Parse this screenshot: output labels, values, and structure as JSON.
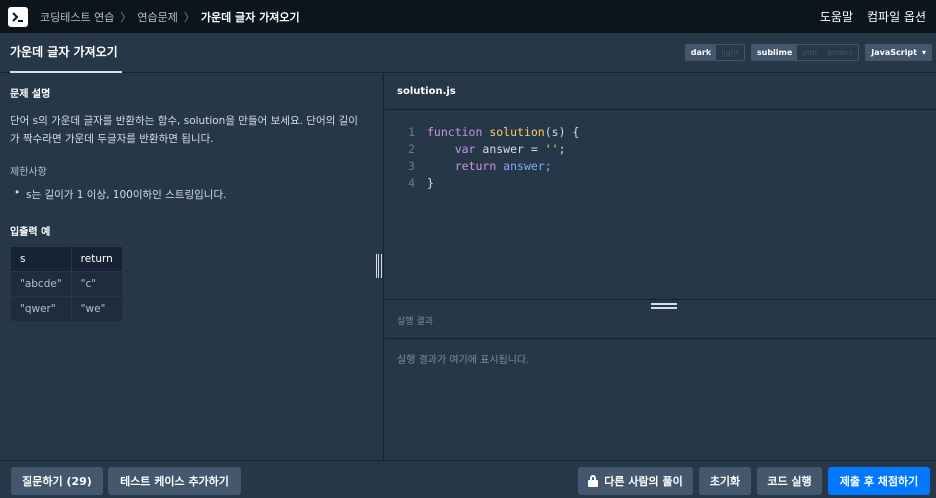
{
  "nav": {
    "breadcrumbs": [
      "코딩테스트 연습",
      "연습문제",
      "가운데 글자 가져오기"
    ],
    "separator": "〉",
    "help": "도움말",
    "compile_options": "컴파일 옵션"
  },
  "title_tab": "가운데 글자 가져오기",
  "editor_options": {
    "theme": [
      "dark",
      "light"
    ],
    "theme_selected": "dark",
    "keymap": [
      "sublime",
      "vim",
      "emacs"
    ],
    "keymap_selected": "sublime",
    "language": "JavaScript",
    "dropdown_arrow": "▾"
  },
  "problem": {
    "section_title": "문제 설명",
    "description": "단어 s의 가운데 글자를 반환하는 함수, solution을 만들어 보세요. 단어의 길이가 짝수라면 가운데 두글자를 반환하면 됩니다.",
    "constraints_title": "제한사항",
    "constraints": [
      "s는 길이가 1 이상, 100이하인 스트링입니다."
    ],
    "io_title": "입출력 예",
    "io_table": {
      "headers": [
        "s",
        "return"
      ],
      "rows": [
        [
          "\"abcde\"",
          "\"c\""
        ],
        [
          "\"qwer\"",
          "\"we\""
        ]
      ]
    }
  },
  "editor": {
    "filename": "solution.js",
    "line_numbers": [
      "1",
      "2",
      "3",
      "4"
    ],
    "lines": [
      [
        "function",
        " ",
        "solution",
        "(s) {"
      ],
      [
        "    ",
        "var",
        " answer = ",
        "''",
        ";"
      ],
      [
        "    ",
        "return",
        " answer;"
      ],
      [
        "}"
      ]
    ]
  },
  "result": {
    "title": "실행 결과",
    "placeholder": "실행 결과가 여기에 표시됩니다."
  },
  "footer": {
    "ask": "질문하기 (29)",
    "add_testcase": "테스트 케이스 추가하기",
    "others_solutions": "다른 사람의 풀이",
    "reset": "초기화",
    "run": "코드 실행",
    "submit": "제출 후 채점하기"
  },
  "colors": {
    "background": "#263747",
    "topbar": "#0c151c",
    "primary_button": "#0078ff",
    "secondary_button": "#44576c"
  }
}
